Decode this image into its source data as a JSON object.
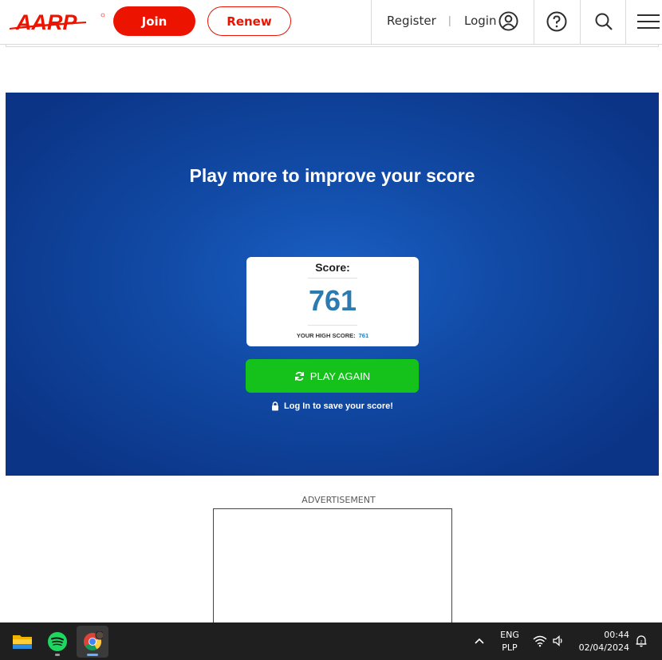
{
  "header": {
    "logo_text": "AARP",
    "join_label": "Join",
    "renew_label": "Renew",
    "register_label": "Register",
    "separator": "|",
    "login_label": "Login",
    "icons": [
      "account-icon",
      "help-icon",
      "search-icon",
      "menu-icon"
    ]
  },
  "game": {
    "title": "Play more to improve your score",
    "score_label": "Score:",
    "score_value": "761",
    "high_score_label": "YOUR HIGH SCORE:",
    "high_score_value": "761",
    "play_again_label": "PLAY AGAIN",
    "login_save_label": "Log In to save your score!"
  },
  "advertisement": {
    "label": "ADVERTISEMENT"
  },
  "taskbar": {
    "apps": [
      "file-explorer-icon",
      "spotify-icon",
      "chrome-icon"
    ],
    "language_line1": "ENG",
    "language_line2": "PLP",
    "time": "00:44",
    "date": "02/04/2024"
  },
  "colors": {
    "brand_red": "#ec1300",
    "game_blue": "#114aa5",
    "play_green": "#14c21b",
    "score_blue": "#2b7bb0"
  }
}
